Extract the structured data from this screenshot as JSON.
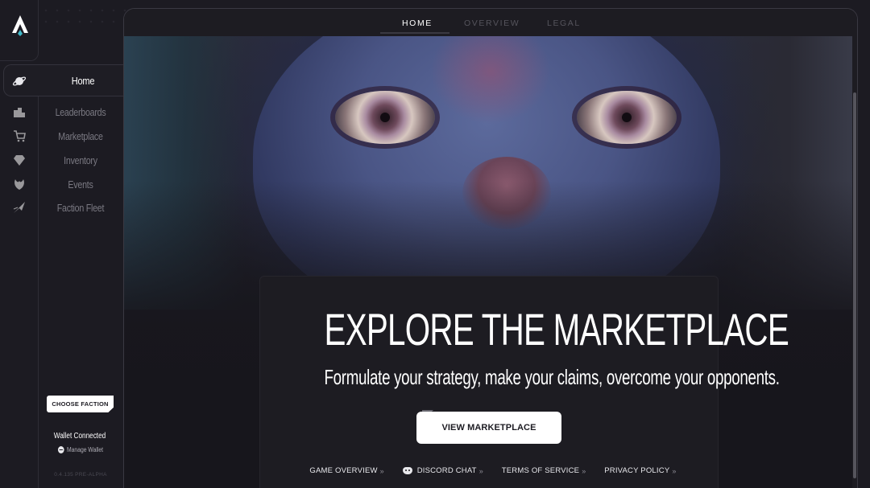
{
  "app": {
    "logo": "a-logo-icon"
  },
  "nav": {
    "home": {
      "label": "Home",
      "icon": "planet-icon"
    },
    "items": [
      {
        "label": "Leaderboards",
        "icon": "podium-icon"
      },
      {
        "label": "Marketplace",
        "icon": "cart-icon"
      },
      {
        "label": "Inventory",
        "icon": "diamond-icon"
      },
      {
        "label": "Events",
        "icon": "phoenix-icon"
      },
      {
        "label": "Faction Fleet",
        "icon": "ship-icon"
      }
    ]
  },
  "sidebar_footer": {
    "choose_faction": "CHOOSE FACTION",
    "wallet_status": "Wallet Connected",
    "manage_wallet": "Manage Wallet",
    "version": "0.4.135 PRE-ALPHA"
  },
  "tabs": [
    {
      "label": "HOME",
      "active": true
    },
    {
      "label": "OVERVIEW",
      "active": false
    },
    {
      "label": "LEGAL",
      "active": false
    }
  ],
  "hero": {
    "title": "EXPLORE THE MARKETPLACE",
    "subtitle": "Formulate your strategy, make your claims, overcome your opponents.",
    "cta": "VIEW MARKETPLACE"
  },
  "links": [
    {
      "label": "GAME OVERVIEW",
      "icon": ""
    },
    {
      "label": "DISCORD CHAT",
      "icon": "discord-icon"
    },
    {
      "label": "TERMS OF SERVICE",
      "icon": ""
    },
    {
      "label": "PRIVACY POLICY",
      "icon": ""
    }
  ],
  "colors": {
    "bg": "#1c1b22",
    "panel": "#1d1c22",
    "accent": "#ffffff",
    "muted": "#7a7982"
  }
}
